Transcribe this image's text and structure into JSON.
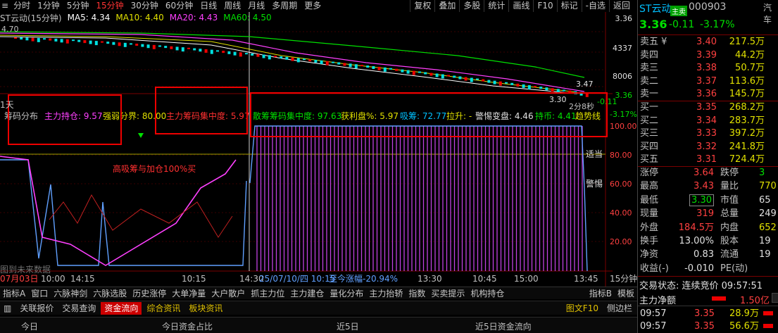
{
  "topbar": {
    "left_items": [
      "分时",
      "1分钟",
      "5分钟",
      "15分钟",
      "30分钟",
      "60分钟",
      "日线",
      "周线",
      "月线",
      "多周期",
      "更多"
    ],
    "active_index": 3,
    "right_items": [
      "复权",
      "叠加",
      "多股",
      "统计",
      "画线",
      "F10",
      "标记",
      "-自选",
      "返回"
    ]
  },
  "maline": {
    "title": "ST云动(15分钟)",
    "ma5": "MA5: 4.34",
    "ma10": "MA10: 4.40",
    "ma20": "MA20: 4.43",
    "ma60": "MA60: 4.50",
    "colors": {
      "ma5": "#ffffff",
      "ma10": "#e0e000",
      "ma20": "#ff40ff",
      "ma60": "#00e000"
    }
  },
  "price_axis": [
    "3.36",
    "4337",
    "8006",
    "3.36"
  ],
  "price_labels": {
    "top_left": "4.70",
    "right_high": "3.47",
    "right_low": "3.30",
    "right_cur": "-0.11",
    "countdown": "2分8秒"
  },
  "indicator": {
    "title": "筹码分布",
    "main_hold": "主力持仓: 9.57",
    "strong_weak": "强弱分界: 80.00",
    "main_conc": "主力筹码集中度: 5.97",
    "scatter_conc": "散筹筹码集中度: 97.63",
    "profit": "获利盘%: 5.97",
    "absorb": "吸筹: 72.77",
    "raise": "拉升: -",
    "alert": "警惕变盘: 4.46",
    "hold_coin": "持币: 4.41",
    "trend": "趋势线",
    "annotation": "高吸筹与加仓100%买",
    "side_label1": "适当",
    "side_label2": "警惕",
    "future_note": "图到未来数据",
    "day_label": "1天",
    "axis": [
      "-3.17%",
      "100.00",
      "80.00",
      "60.00",
      "40.00",
      "20.00"
    ]
  },
  "time_axis": {
    "labels": [
      "07月03日",
      "10:00",
      "14:15",
      "10:15",
      "14:30",
      "25/07/10/四 10:15",
      "至今涨幅-20.94%",
      "13:30",
      "10:45",
      "15:00",
      "13:45"
    ],
    "period": "15分钟"
  },
  "tabs1": [
    "指标A",
    "窗口",
    "六脉神剑",
    "六脉选股",
    "历史涨停",
    "大单净量",
    "大户散户",
    "抓主力位",
    "主力建仓",
    "量化分布",
    "主力抬轿",
    "指数",
    "买卖提示",
    "机构持仓",
    "指标B",
    "模板"
  ],
  "tabs2": {
    "items": [
      "关联报价",
      "交易查询",
      "资金流向",
      "综合资讯",
      "板块资讯"
    ],
    "active_index": 2,
    "right": [
      "图文F10",
      "侧边栏"
    ]
  },
  "tabs3": [
    "今日",
    "今日资金占比",
    "近5日",
    "近5日资金流向"
  ],
  "quote": {
    "name": "ST云动",
    "badge": "主卖",
    "code": "000903",
    "extra": "汽车",
    "price": "3.36",
    "change": "-0.11",
    "pct": "-3.17%",
    "sells": [
      {
        "label": "卖五 ¥",
        "price": "3.40",
        "vol": "217.5万"
      },
      {
        "label": "卖四",
        "price": "3.39",
        "vol": "44.2万"
      },
      {
        "label": "卖三",
        "price": "3.38",
        "vol": "50.7万"
      },
      {
        "label": "卖二",
        "price": "3.37",
        "vol": "113.6万"
      },
      {
        "label": "卖一",
        "price": "3.36",
        "vol": "145.7万"
      }
    ],
    "buys": [
      {
        "label": "买一",
        "price": "3.35",
        "vol": "268.2万"
      },
      {
        "label": "买二",
        "price": "3.34",
        "vol": "283.7万"
      },
      {
        "label": "买三",
        "price": "3.33",
        "vol": "397.2万"
      },
      {
        "label": "买四",
        "price": "3.32",
        "vol": "241.8万"
      },
      {
        "label": "买五",
        "price": "3.31",
        "vol": "724.4万"
      }
    ],
    "stats": [
      {
        "k1": "涨停",
        "v1": "3.64",
        "k2": "跌停",
        "v2": "3"
      },
      {
        "k1": "最高",
        "v1": "3.43",
        "k2": "量比",
        "v2": "770"
      },
      {
        "k1": "最低",
        "v1": "3.30",
        "k2": "市值",
        "v2": "65"
      },
      {
        "k1": "现量",
        "v1": "319",
        "k2": "总量",
        "v2": "249"
      },
      {
        "k1": "外盘",
        "v1": "184.5万",
        "k2": "内盘",
        "v2": "652"
      },
      {
        "k1": "换手",
        "v1": "13.00%",
        "k2": "股本",
        "v2": "19"
      },
      {
        "k1": "净资",
        "v1": "0.83",
        "k2": "流通",
        "v2": "19"
      },
      {
        "k1": "收益(-)",
        "v1": "-0.010",
        "k2": "PE(动)",
        "v2": ""
      }
    ],
    "trade_status": "交易状态: 连续竞价 09:57:51",
    "main_net": "主力净额",
    "main_net_val": "1.50亿",
    "ticks": [
      {
        "time": "09:57",
        "price": "3.35",
        "vol": "28.9万"
      },
      {
        "time": "09:57",
        "price": "3.35",
        "vol": "56.6万"
      }
    ]
  }
}
